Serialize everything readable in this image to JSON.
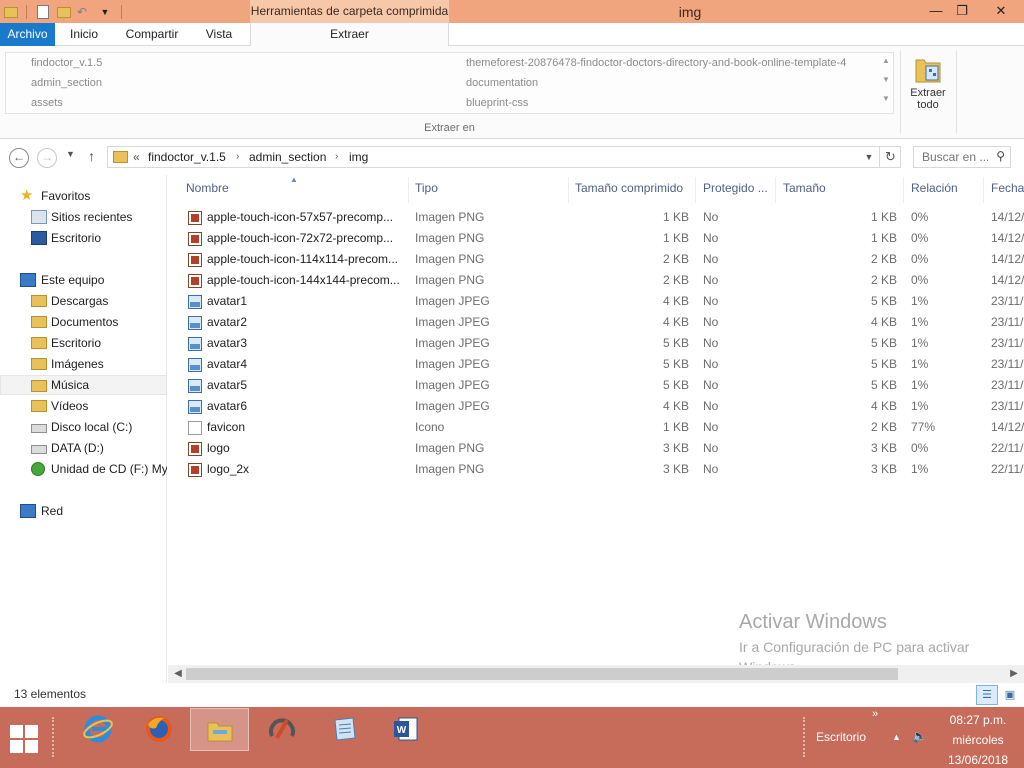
{
  "window": {
    "title": "img",
    "context_tab_title": "Herramientas de carpeta comprimida",
    "minimize": "—",
    "maximize": "❐",
    "close": "✕"
  },
  "ribbon": {
    "tabs": [
      "Archivo",
      "Inicio",
      "Compartir",
      "Vista",
      "Extraer"
    ],
    "active_tab": "Extraer",
    "destinations": [
      "findoctor_v.1.5",
      "admin_section",
      "assets",
      "themeforest-20876478-findoctor-doctors-directory-and-book-online-template-4",
      "documentation",
      "blueprint-css"
    ],
    "group_label": "Extraer en",
    "extract_all": [
      "Extraer",
      "todo"
    ]
  },
  "address": {
    "overflow": "«",
    "crumbs": [
      "findoctor_v.1.5",
      "admin_section",
      "img"
    ],
    "search_placeholder": "Buscar en ..."
  },
  "sidebar": {
    "items": [
      {
        "label": "Favoritos",
        "icon": "star-icon"
      },
      {
        "label": "Sitios recientes",
        "icon": "recent-places-icon"
      },
      {
        "label": "Escritorio",
        "icon": "desktop-icon"
      },
      {
        "label": "Este equipo",
        "icon": "computer-icon"
      },
      {
        "label": "Descargas",
        "icon": "folder-icon"
      },
      {
        "label": "Documentos",
        "icon": "folder-icon"
      },
      {
        "label": "Escritorio",
        "icon": "folder-icon"
      },
      {
        "label": "Imágenes",
        "icon": "folder-icon"
      },
      {
        "label": "Música",
        "icon": "folder-icon"
      },
      {
        "label": "Vídeos",
        "icon": "folder-icon"
      },
      {
        "label": "Disco local (C:)",
        "icon": "drive-icon"
      },
      {
        "label": "DATA (D:)",
        "icon": "drive-icon"
      },
      {
        "label": "Unidad de CD (F:) My",
        "icon": "cd-drive-icon"
      },
      {
        "label": "Red",
        "icon": "network-icon"
      }
    ],
    "selected": "Música"
  },
  "columns": [
    "Nombre",
    "Tipo",
    "Tamaño comprimido",
    "Protegido ...",
    "Tamaño",
    "Relación",
    "Fecha"
  ],
  "files": [
    {
      "name": "apple-touch-icon-57x57-precomp...",
      "type": "Imagen PNG",
      "compressed": "1 KB",
      "protected": "No",
      "size": "1 KB",
      "ratio": "0%",
      "date": "14/12/",
      "icon": "png"
    },
    {
      "name": "apple-touch-icon-72x72-precomp...",
      "type": "Imagen PNG",
      "compressed": "1 KB",
      "protected": "No",
      "size": "1 KB",
      "ratio": "0%",
      "date": "14/12/",
      "icon": "png"
    },
    {
      "name": "apple-touch-icon-114x114-precom...",
      "type": "Imagen PNG",
      "compressed": "2 KB",
      "protected": "No",
      "size": "2 KB",
      "ratio": "0%",
      "date": "14/12/",
      "icon": "png"
    },
    {
      "name": "apple-touch-icon-144x144-precom...",
      "type": "Imagen PNG",
      "compressed": "2 KB",
      "protected": "No",
      "size": "2 KB",
      "ratio": "0%",
      "date": "14/12/",
      "icon": "png"
    },
    {
      "name": "avatar1",
      "type": "Imagen JPEG",
      "compressed": "4 KB",
      "protected": "No",
      "size": "5 KB",
      "ratio": "1%",
      "date": "23/11/",
      "icon": "jpeg"
    },
    {
      "name": "avatar2",
      "type": "Imagen JPEG",
      "compressed": "4 KB",
      "protected": "No",
      "size": "4 KB",
      "ratio": "1%",
      "date": "23/11/",
      "icon": "jpeg"
    },
    {
      "name": "avatar3",
      "type": "Imagen JPEG",
      "compressed": "5 KB",
      "protected": "No",
      "size": "5 KB",
      "ratio": "1%",
      "date": "23/11/",
      "icon": "jpeg"
    },
    {
      "name": "avatar4",
      "type": "Imagen JPEG",
      "compressed": "5 KB",
      "protected": "No",
      "size": "5 KB",
      "ratio": "1%",
      "date": "23/11/",
      "icon": "jpeg"
    },
    {
      "name": "avatar5",
      "type": "Imagen JPEG",
      "compressed": "5 KB",
      "protected": "No",
      "size": "5 KB",
      "ratio": "1%",
      "date": "23/11/",
      "icon": "jpeg"
    },
    {
      "name": "avatar6",
      "type": "Imagen JPEG",
      "compressed": "4 KB",
      "protected": "No",
      "size": "4 KB",
      "ratio": "1%",
      "date": "23/11/",
      "icon": "jpeg"
    },
    {
      "name": "favicon",
      "type": "Icono",
      "compressed": "1 KB",
      "protected": "No",
      "size": "2 KB",
      "ratio": "77%",
      "date": "14/12/",
      "icon": "ico"
    },
    {
      "name": "logo",
      "type": "Imagen PNG",
      "compressed": "3 KB",
      "protected": "No",
      "size": "3 KB",
      "ratio": "0%",
      "date": "22/11/",
      "icon": "png"
    },
    {
      "name": "logo_2x",
      "type": "Imagen PNG",
      "compressed": "3 KB",
      "protected": "No",
      "size": "3 KB",
      "ratio": "1%",
      "date": "22/11/",
      "icon": "png"
    }
  ],
  "watermark": {
    "title": "Activar Windows",
    "subtitle": "Ir a Configuración de PC para activar Windows."
  },
  "status": {
    "count": "13 elementos"
  },
  "taskbar": {
    "apps": [
      "internet-explorer-icon",
      "firefox-icon",
      "file-explorer-icon",
      "app-icon",
      "notepad-icon",
      "word-icon"
    ],
    "desktop_label": "Escritorio",
    "overflow": "»",
    "time": "08:27 p.m.",
    "day": "miércoles",
    "date": "13/06/2018"
  },
  "colors": {
    "titlebar": "#f0a57e",
    "accent": "#1979ca",
    "taskbar": "#c76b5b"
  }
}
